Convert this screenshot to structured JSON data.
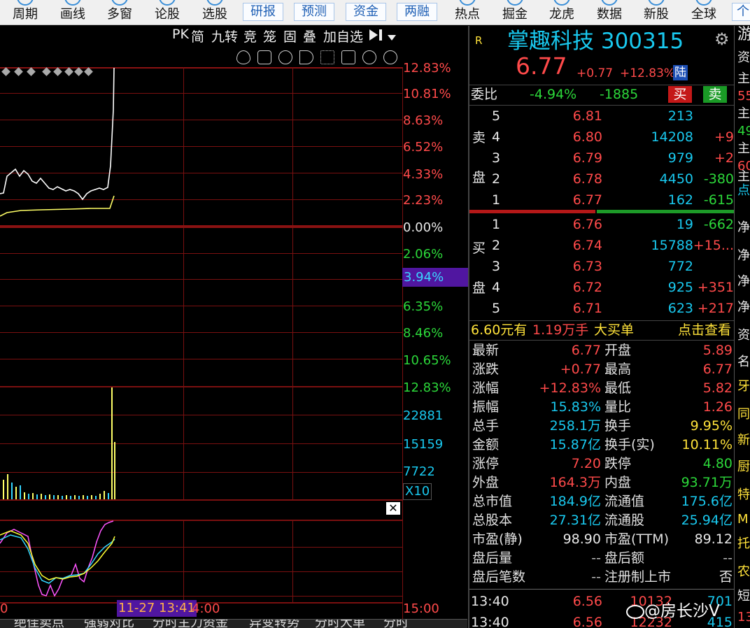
{
  "toolbar": {
    "items": [
      "周期",
      "画线",
      "多窗",
      "论股",
      "选股"
    ],
    "buttons": [
      "研报",
      "预测",
      "资金",
      "两融"
    ],
    "items2": [
      "热点",
      "掘金",
      "龙虎",
      "数据",
      "新股",
      "全球"
    ],
    "last": "个"
  },
  "chart_toolbar": [
    "PK",
    "简",
    "九转",
    "竞",
    "笼",
    "固",
    "叠",
    "加自选"
  ],
  "chart": {
    "price_labels_up": [
      "12.83%",
      "10.81%",
      "8.63%",
      "6.52%",
      "4.33%",
      "2.23%"
    ],
    "zero_label": "0.00%",
    "price_labels_down": [
      "2.06%",
      "3.94%",
      "6.35%",
      "8.46%",
      "10.65%",
      "12.83%"
    ],
    "volume_labels": [
      "22881",
      "15159",
      "7722"
    ],
    "multiplier": "X10",
    "time_start": "0",
    "time_cursor": "11-27 13:41",
    "time_mid": "4:00",
    "time_end": "15:00",
    "bottom_tabs": [
      "绝佳卖点",
      "强弱对比",
      "分时主力资金",
      "异变转势",
      "分时大单",
      "分时"
    ]
  },
  "stock": {
    "tag": "R",
    "name": "掌趣科技",
    "code": "300315",
    "price": "6.77",
    "change": "+0.77",
    "change_pct": "+12.83%",
    "badge": "陆"
  },
  "weibi": {
    "label": "委比",
    "pct": "-4.94%",
    "diff": "-1885",
    "buy_btn": "买",
    "sell_btn": "卖"
  },
  "sell_side": {
    "label1": "卖",
    "label2": "盘",
    "rows": [
      {
        "lvl": "5",
        "price": "6.81",
        "vol": "213",
        "chg": ""
      },
      {
        "lvl": "4",
        "price": "6.80",
        "vol": "14208",
        "chg": "+9"
      },
      {
        "lvl": "3",
        "price": "6.79",
        "vol": "979",
        "chg": "+2"
      },
      {
        "lvl": "2",
        "price": "6.78",
        "vol": "4450",
        "chg": "-380"
      },
      {
        "lvl": "1",
        "price": "6.77",
        "vol": "162",
        "chg": "-615"
      }
    ]
  },
  "buy_side": {
    "label1": "买",
    "label2": "盘",
    "rows": [
      {
        "lvl": "1",
        "price": "6.76",
        "vol": "19",
        "chg": "-662"
      },
      {
        "lvl": "2",
        "price": "6.74",
        "vol": "15788",
        "chg": "+15..."
      },
      {
        "lvl": "3",
        "price": "6.73",
        "vol": "772",
        "chg": ""
      },
      {
        "lvl": "4",
        "price": "6.72",
        "vol": "925",
        "chg": "+351"
      },
      {
        "lvl": "5",
        "price": "6.71",
        "vol": "623",
        "chg": "+217"
      }
    ]
  },
  "bigorder": {
    "price": "6.60元有",
    "qty": "1.19万手",
    "label": "大买单",
    "link": "点击查看"
  },
  "stats": [
    {
      "l1": "最新",
      "v1": "6.77",
      "c1": "red",
      "l2": "开盘",
      "v2": "5.89",
      "c2": "red"
    },
    {
      "l1": "涨跌",
      "v1": "+0.77",
      "c1": "red",
      "l2": "最高",
      "v2": "6.77",
      "c2": "red"
    },
    {
      "l1": "涨幅",
      "v1": "+12.83%",
      "c1": "red",
      "l2": "最低",
      "v2": "5.82",
      "c2": "red"
    },
    {
      "l1": "振幅",
      "v1": "15.83%",
      "c1": "cyan",
      "l2": "量比",
      "v2": "1.26",
      "c2": "red"
    },
    {
      "l1": "总手",
      "v1": "258.1万",
      "c1": "cyan",
      "l2": "换手",
      "v2": "9.95%",
      "c2": "yel"
    },
    {
      "l1": "金额",
      "v1": "15.87亿",
      "c1": "cyan",
      "l2": "换手(实)",
      "v2": "10.11%",
      "c2": "yel"
    },
    {
      "l1": "涨停",
      "v1": "7.20",
      "c1": "red",
      "l2": "跌停",
      "v2": "4.80",
      "c2": "grn"
    },
    {
      "l1": "外盘",
      "v1": "164.3万",
      "c1": "red",
      "l2": "内盘",
      "v2": "93.71万",
      "c2": "grn"
    },
    {
      "l1": "总市值",
      "v1": "184.9亿",
      "c1": "cyan",
      "l2": "流通值",
      "v2": "175.6亿",
      "c2": "cyan"
    },
    {
      "l1": "总股本",
      "v1": "27.31亿",
      "c1": "cyan",
      "l2": "流通股",
      "v2": "25.94亿",
      "c2": "cyan"
    },
    {
      "l1": "市盈(静)",
      "v1": "98.90",
      "c1": "wht",
      "l2": "市盈(TTM)",
      "v2": "89.12",
      "c2": "wht"
    },
    {
      "l1": "盘后量",
      "v1": "--",
      "c1": "gry",
      "l2": "盘后额",
      "v2": "--",
      "c2": "gry"
    },
    {
      "l1": "盘后笔数",
      "v1": "--",
      "c1": "gry",
      "l2": "注册制上市",
      "v2": "否",
      "c2": "wht"
    }
  ],
  "ticks": [
    {
      "time": "13:40",
      "price": "6.56",
      "vol": "10132",
      "num": "701"
    },
    {
      "time": "13:40",
      "price": "6.56",
      "vol": "12232",
      "num": "415"
    }
  ],
  "far_right": {
    "title": "游",
    "items": [
      "资",
      "主",
      "55",
      "主",
      "49",
      "主",
      "60",
      "主",
      "点",
      "净",
      "净",
      "净",
      "净",
      "资",
      "名",
      "牙",
      "同",
      "新",
      "厨",
      "特",
      "M",
      "托",
      "农",
      "短",
      "13"
    ]
  },
  "watermark": "@房长沙V"
}
